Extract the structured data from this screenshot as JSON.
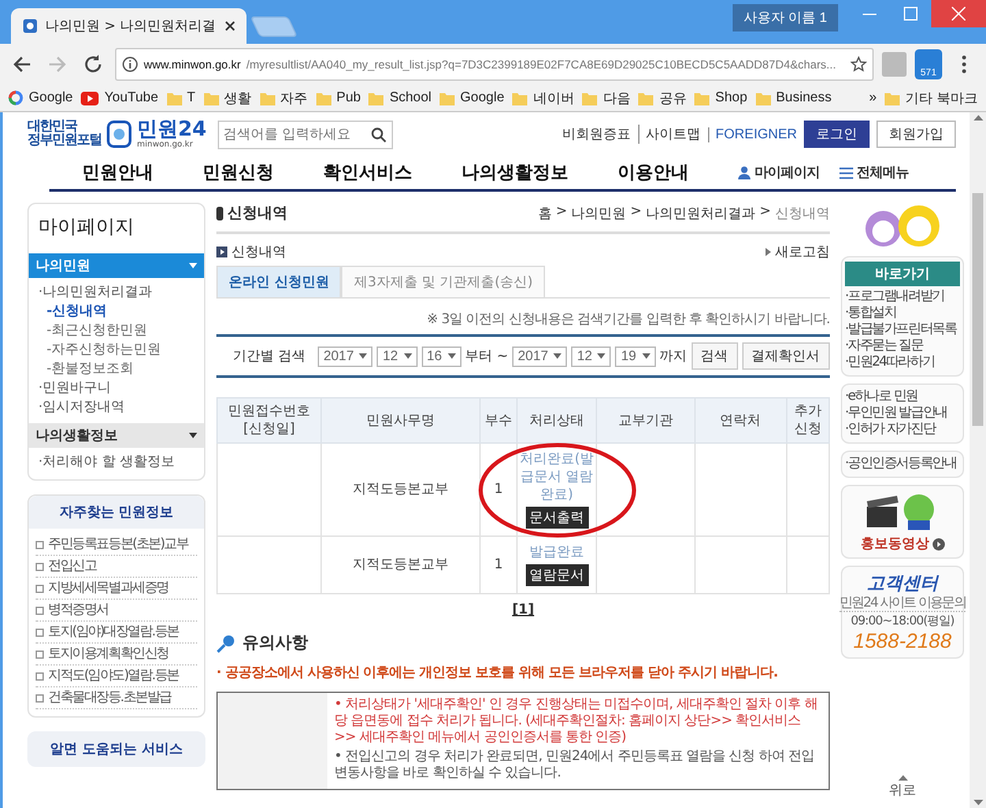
{
  "browser": {
    "tabs": [
      {
        "title": "나의민원 > 나의민원처리결",
        "selected": true
      }
    ],
    "profile": "사용자 이름 1",
    "url_host": "www.minwon.go.kr",
    "url_path": "/myresultlist/AA040_my_result_list.jsp?q=7D3C2399189E02F7CA8E69D29025C10BECD5C5AADD87D4&chars...",
    "extension_badge": "571",
    "bookmarks": [
      {
        "label": "Google",
        "kind": "google"
      },
      {
        "label": "YouTube",
        "kind": "youtube"
      },
      {
        "label": "T",
        "kind": "folder"
      },
      {
        "label": "생활",
        "kind": "folder"
      },
      {
        "label": "자주",
        "kind": "folder"
      },
      {
        "label": "Pub",
        "kind": "folder"
      },
      {
        "label": "School",
        "kind": "folder"
      },
      {
        "label": "Google",
        "kind": "folder"
      },
      {
        "label": "네이버",
        "kind": "folder"
      },
      {
        "label": "다음",
        "kind": "folder"
      },
      {
        "label": "공유",
        "kind": "folder"
      },
      {
        "label": "Shop",
        "kind": "folder"
      },
      {
        "label": "Business",
        "kind": "folder"
      },
      {
        "label": "»",
        "kind": "more"
      },
      {
        "label": "기타 북마크",
        "kind": "folder"
      }
    ]
  },
  "header": {
    "logo_caption": [
      "대한민국",
      "정부민원포털"
    ],
    "logo_name": "민원24",
    "logo_domain": "minwon.go.kr",
    "search_placeholder": "검색어를 입력하세요",
    "links": [
      "비회원증표",
      "사이트맵",
      "FOREIGNER"
    ],
    "buttons": [
      {
        "label": "로그인",
        "kind": "primary"
      },
      {
        "label": "회원가입",
        "kind": "secondary"
      }
    ]
  },
  "nav": {
    "items": [
      "민원안내",
      "민원신청",
      "확인서비스",
      "나의생활정보",
      "이용안내"
    ],
    "utilities": [
      {
        "label": "마이페이지",
        "kind": "person"
      },
      {
        "label": "전체메뉴",
        "kind": "list"
      }
    ]
  },
  "sidebar": {
    "title": "마이페이지",
    "sections": [
      {
        "label": "나의민원",
        "selected": true,
        "items": [
          {
            "label": "·나의민원처리결과",
            "children": [
              {
                "label": "-신청내역",
                "selected": true
              },
              {
                "label": "-최근신청한민원",
                "selected": false
              },
              {
                "label": "-자주신청하는민원",
                "selected": false
              },
              {
                "label": "-환불정보조회",
                "selected": false
              }
            ]
          },
          {
            "label": "·민원바구니"
          },
          {
            "label": "·임시저장내역"
          }
        ]
      },
      {
        "label": "나의생활정보",
        "selected": false,
        "items": [
          {
            "label": "·처리해야 할 생활정보"
          }
        ]
      }
    ],
    "favorites": {
      "title": "자주찾는 민원정보",
      "items": [
        "주민등록표등본(초본)교부",
        "전입신고",
        "지방세세목별과세증명",
        "병적증명서",
        "토지(임야)대장열람.등본",
        "토지이용계획확인신청",
        "지적도(임야도)열람.등본",
        "건축물대장등.초본발급"
      ]
    },
    "help_title": "알면 도움되는 서비스"
  },
  "main": {
    "page_title": "신청내역",
    "breadcrumb": [
      "홈",
      "나의민원",
      "나의민원처리결과",
      "신청내역"
    ],
    "breadcrumb_separator": ">",
    "section_title": "신청내역",
    "refresh": "새로고침",
    "tabs": [
      {
        "label": "온라인 신청민원",
        "selected": true
      },
      {
        "label": "제3자제출 및 기관제출(송신)",
        "selected": false
      }
    ],
    "notice": "※ 3일 이전의 신청내용은 검색기간를 입력한 후 확인하시기 바랍니다.",
    "search": {
      "label": "기간별 검색",
      "from": [
        "2017",
        "12",
        "16"
      ],
      "from_word": "부터",
      "range_mark": "~",
      "to": [
        "2017",
        "12",
        "19"
      ],
      "to_word": "까지",
      "buttons": [
        "검색",
        "결제확인서"
      ]
    },
    "table": {
      "columns": [
        {
          "label": "민원접수번호",
          "sub": "[신청일]"
        },
        {
          "label": "민원사무명"
        },
        {
          "label": "부수"
        },
        {
          "label": "처리상태"
        },
        {
          "label": "교부기관"
        },
        {
          "label": "연락처"
        },
        {
          "label": "추가 신청"
        }
      ],
      "rows": [
        {
          "name": "지적도등본교부",
          "copies": "1",
          "status": "처리완료(발급문서 열람완료)",
          "action": "문서출력",
          "highlighted": true
        },
        {
          "name": "지적도등본교부",
          "copies": "1",
          "status": "발급완료",
          "action": "열람문서",
          "highlighted": false
        }
      ]
    },
    "pagination": [
      "[1]"
    ],
    "notes": {
      "title": "유의사항",
      "warning": "· 공공장소에서 사용하신 이후에는 개인정보 보호를 위해 모든 브라우저를 닫아 주시기 바랍니다.",
      "items": [
        {
          "text": "• 처리상태가 '세대주확인' 인 경우 진행상태는 미접수이며, 세대주확인 절차 이후 해당 읍면동에 접수 처리가 됩니다. (세대주확인절차: 홈페이지 상단>> 확인서비스 >> 세대주확인 메뉴에서 공인인증서를 통한 인증)",
          "emphasis": true
        },
        {
          "text": "• 전입신고의 경우 처리가 완료되면, 민원24에서 주민등록표 열람을 신청 하여 전입변동사항을 바로 확인하실 수 있습니다.",
          "emphasis": false
        }
      ]
    }
  },
  "right": {
    "quick": {
      "title": "바로가기",
      "items": [
        "·프로그램내려받기",
        "·통합설치",
        "·발급불가프린터목록",
        "·자주묻는 질문",
        "·민원24따라하기"
      ]
    },
    "services": [
      "·e하나로 민원",
      "·무인민원 발급안내",
      "·인허가 자가진단"
    ],
    "cert": [
      "·공인인증서등록안내"
    ],
    "video": "홍보동영상",
    "support": {
      "title": "고객센터",
      "caption": "민원24 사이트 이용문의",
      "hours": "09:00~18:00(평일)",
      "phone": "1588-2188"
    },
    "top_button": "위로"
  }
}
